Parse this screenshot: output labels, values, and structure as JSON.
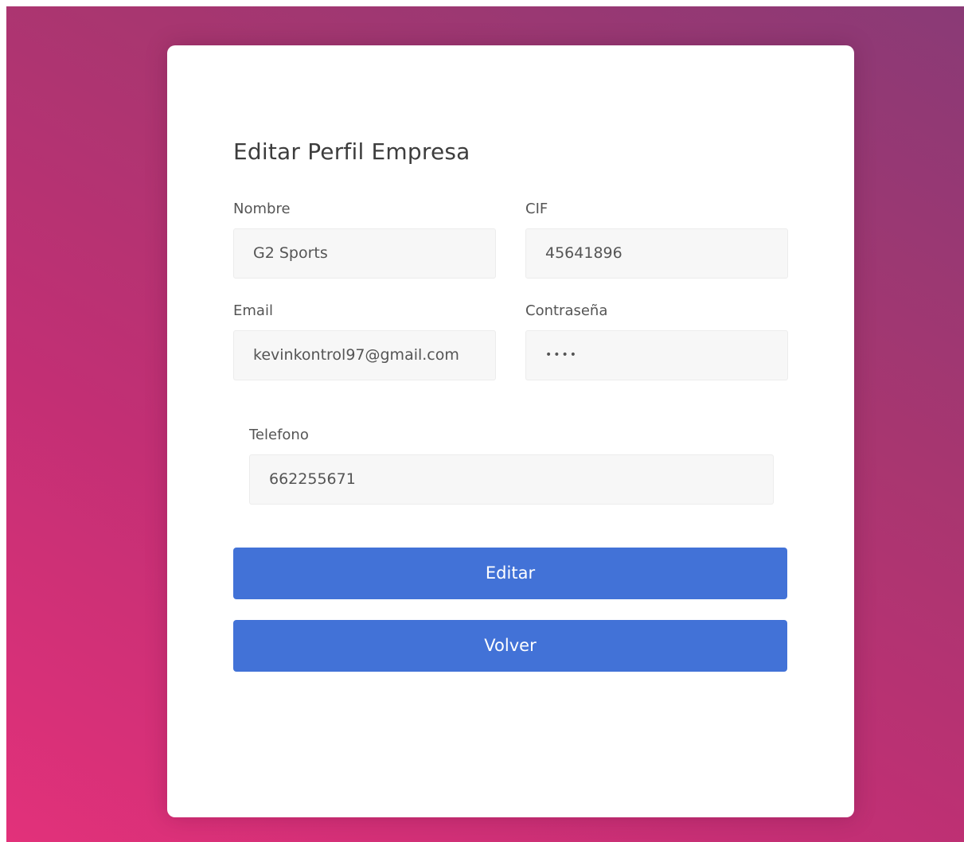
{
  "form": {
    "title": "Editar Perfil Empresa",
    "fields": {
      "nombre": {
        "label": "Nombre",
        "value": "G2 Sports"
      },
      "cif": {
        "label": "CIF",
        "value": "45641896"
      },
      "email": {
        "label": "Email",
        "value": "kevinkontrol97@gmail.com"
      },
      "password": {
        "label": "Contraseña",
        "value": "••••"
      },
      "telefono": {
        "label": "Telefono",
        "value": "662255671"
      }
    },
    "buttons": {
      "edit_label": "Editar",
      "back_label": "Volver"
    }
  },
  "colors": {
    "gradient_start": "#e2317a",
    "gradient_end": "#8a3a76",
    "button": "#4272d7",
    "card": "#ffffff",
    "field_bg": "#f7f7f7"
  }
}
